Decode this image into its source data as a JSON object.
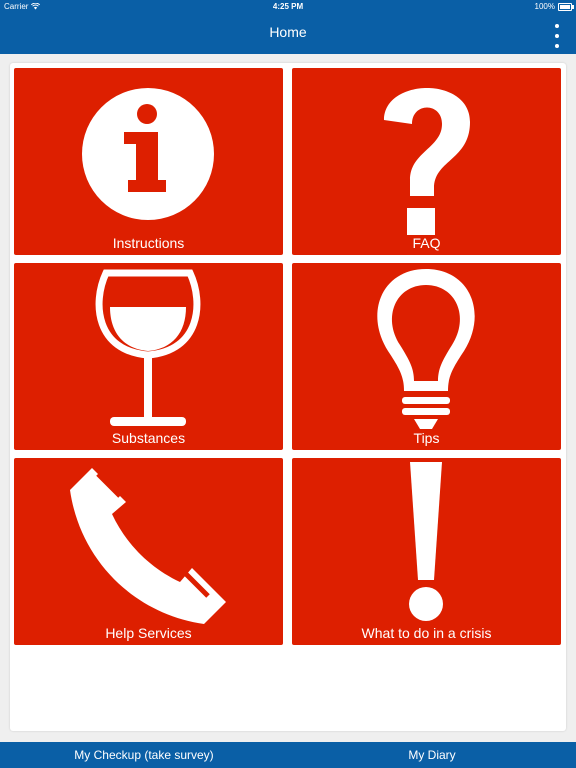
{
  "status_bar": {
    "carrier": "Carrier",
    "time": "4:25 PM",
    "battery": "100%"
  },
  "nav": {
    "title": "Home",
    "menu_icon": "vertical-ellipsis-icon"
  },
  "tiles": [
    {
      "label": "Instructions",
      "icon": "info-icon"
    },
    {
      "label": "FAQ",
      "icon": "question-mark-icon"
    },
    {
      "label": "Substances",
      "icon": "wine-glass-icon"
    },
    {
      "label": "Tips",
      "icon": "light-bulb-icon"
    },
    {
      "label": "Help Services",
      "icon": "phone-icon"
    },
    {
      "label": "What to do in a crisis",
      "icon": "exclamation-icon"
    }
  ],
  "bottom_tabs": [
    {
      "label": "My Checkup (take survey)"
    },
    {
      "label": "My Diary"
    }
  ],
  "colors": {
    "bar_blue": "#0a5fa6",
    "tile_red": "#dd1f00",
    "background": "#efefef"
  }
}
